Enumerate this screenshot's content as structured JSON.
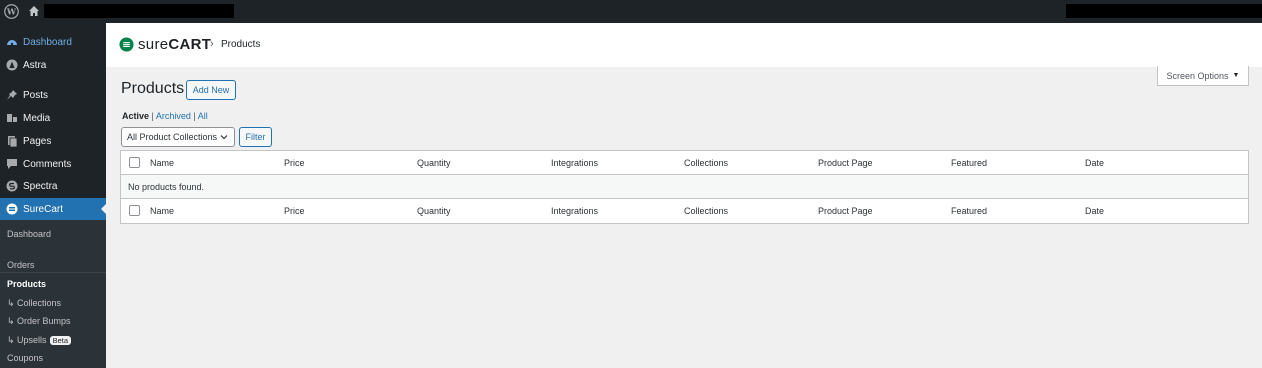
{
  "header": {
    "logo_prefix": "sure",
    "logo_suffix": "CART",
    "breadcrumb_separator": "›",
    "breadcrumb_current": "Products"
  },
  "sidebar": {
    "items": [
      {
        "label": "Dashboard",
        "icon": "dashboard-icon"
      },
      {
        "label": "Astra",
        "icon": "astra-icon"
      },
      {
        "label": "Posts",
        "icon": "pin-icon"
      },
      {
        "label": "Media",
        "icon": "media-icon"
      },
      {
        "label": "Pages",
        "icon": "pages-icon"
      },
      {
        "label": "Comments",
        "icon": "comments-icon"
      },
      {
        "label": "Spectra",
        "icon": "spectra-icon"
      },
      {
        "label": "SureCart",
        "icon": "surecart-icon"
      }
    ],
    "submenu": [
      {
        "label": "Dashboard"
      },
      {
        "label": "Orders"
      },
      {
        "label": "Products"
      },
      {
        "label": "↳ Collections"
      },
      {
        "label": "↳ Order Bumps"
      },
      {
        "label": "↳ Upsells",
        "badge": "Beta"
      },
      {
        "label": "Coupons"
      }
    ]
  },
  "screen_options": {
    "label": "Screen Options",
    "arrow": "▼"
  },
  "page": {
    "title": "Products",
    "add_new": "Add New",
    "filters": {
      "active": "Active",
      "archived": "Archived",
      "all": "All",
      "sep": "|"
    },
    "collection_select": "All Product Collections",
    "filter_button": "Filter"
  },
  "table": {
    "columns": [
      "Name",
      "Price",
      "Quantity",
      "Integrations",
      "Collections",
      "Product Page",
      "Featured",
      "Date"
    ],
    "empty_message": "No products found."
  },
  "colors": {
    "admin_bar": "#1d2327",
    "active_menu": "#2271b1",
    "link": "#2271b1",
    "brand_green": "#01824c"
  }
}
